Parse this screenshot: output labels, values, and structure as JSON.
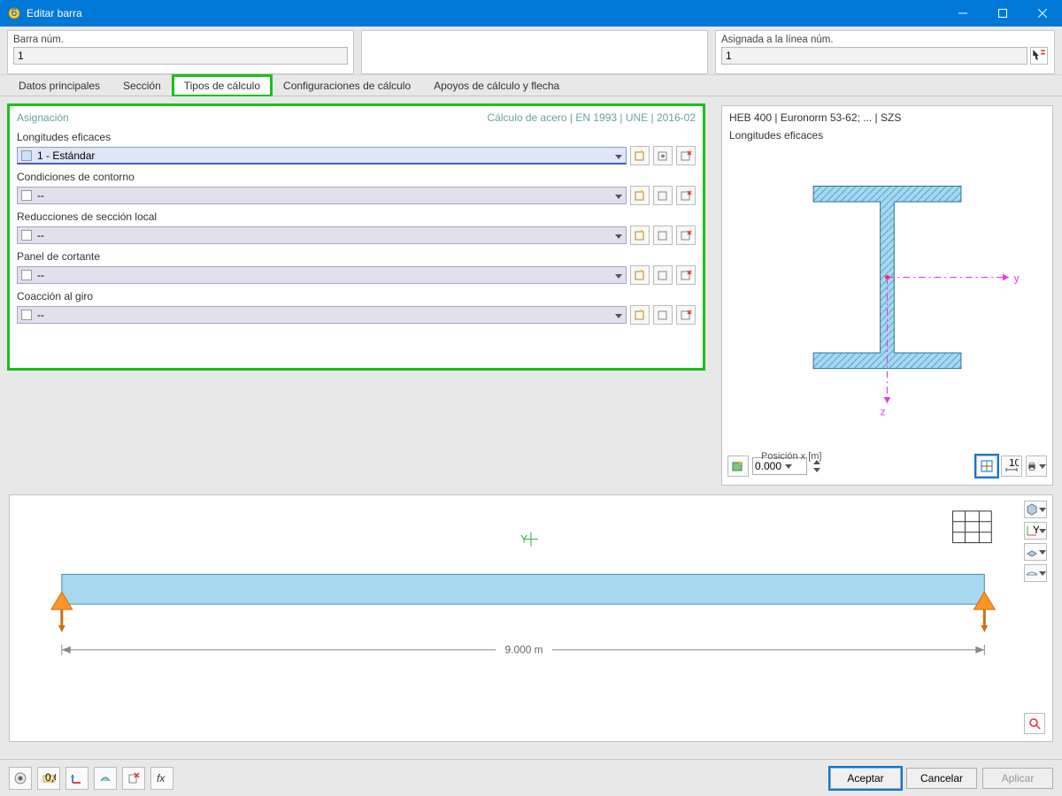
{
  "window": {
    "title": "Editar barra"
  },
  "top": {
    "left_label": "Barra núm.",
    "left_value": "1",
    "right_label": "Asignada a la línea núm.",
    "right_value": "1"
  },
  "tabs": {
    "t0": "Datos principales",
    "t1": "Sección",
    "t2": "Tipos de cálculo",
    "t3": "Configuraciones de cálculo",
    "t4": "Apoyos de cálculo y flecha"
  },
  "assign": {
    "title": "Asignación",
    "standard": "Cálculo de acero | EN 1993 | UNE | 2016-02",
    "fields": {
      "longitudes": {
        "label": "Longitudes eficaces",
        "value": "1 - Estándar"
      },
      "contorno": {
        "label": "Condiciones de contorno",
        "value": "--"
      },
      "reducciones": {
        "label": "Reducciones de sección local",
        "value": "--"
      },
      "panel": {
        "label": "Panel de cortante",
        "value": "--"
      },
      "coaccion": {
        "label": "Coacción al giro",
        "value": "--"
      }
    }
  },
  "preview": {
    "title": "HEB 400 | Euronorm 53-62; ... | SZS",
    "subtitle": "Longitudes eficaces",
    "axis_y": "y",
    "axis_z": "z",
    "pos_label": "Posición x [m]",
    "pos_value": "0.000"
  },
  "beam": {
    "length_label": "9.000 m",
    "y_axis": "Y"
  },
  "buttons": {
    "ok": "Aceptar",
    "cancel": "Cancelar",
    "apply": "Aplicar"
  }
}
